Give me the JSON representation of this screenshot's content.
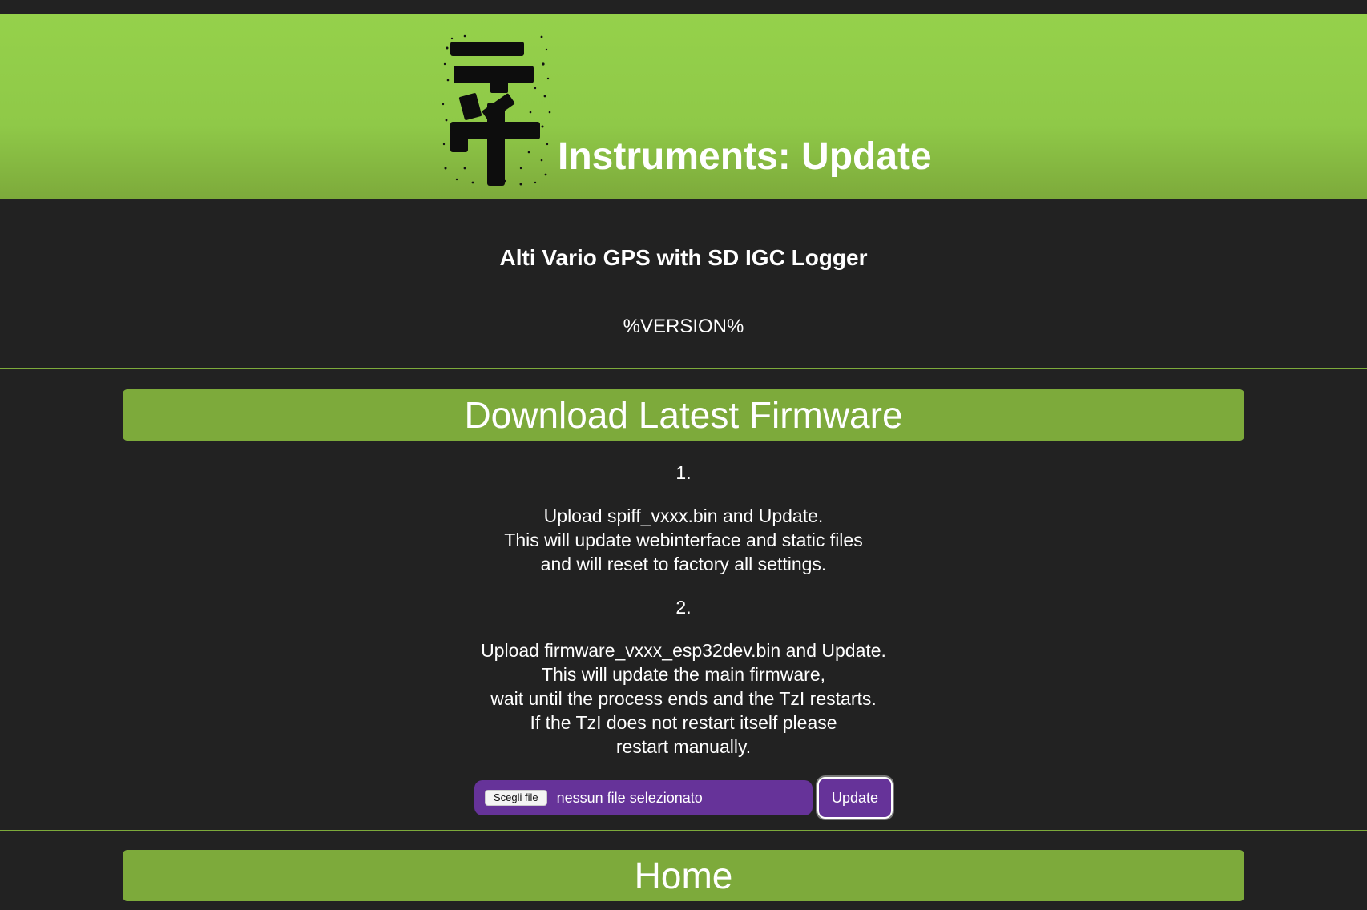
{
  "header": {
    "title": "Instruments: Update",
    "logo_icon": "tzi-logo"
  },
  "device": {
    "name": "Alti Vario GPS with SD IGC Logger",
    "version": "%VERSION%"
  },
  "firmware_section": {
    "title": "Download Latest Firmware",
    "step1_number": "1.",
    "step1_lines": [
      "Upload spiff_vxxx.bin and Update.",
      "This will update webinterface and static files",
      "and will reset to factory all settings."
    ],
    "step2_number": "2.",
    "step2_lines": [
      "Upload firmware_vxxx_esp32dev.bin and Update.",
      "This will update the main firmware,",
      "wait until the process ends and the TzI restarts.",
      "If the TzI does not restart itself please",
      "restart manually."
    ]
  },
  "upload_form": {
    "choose_file_label": "Scegli file",
    "file_status": "nessun file selezionato",
    "update_button": "Update"
  },
  "home_section": {
    "title": "Home"
  },
  "colors": {
    "background": "#222222",
    "accent_green": "#7daa3b",
    "header_green": "#95d14b",
    "purple": "#663399"
  }
}
